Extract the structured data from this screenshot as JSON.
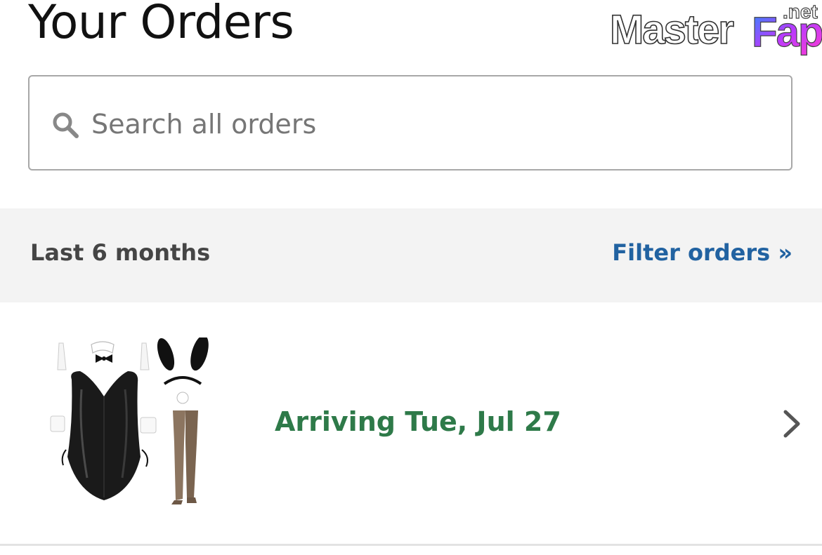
{
  "header": {
    "title": "Your Orders"
  },
  "watermark": {
    "text_main": "Master",
    "text_accent": "Fap",
    "text_suffix": ".net",
    "accent_colors": [
      "#2a8cff",
      "#b63bff",
      "#ff3bd1"
    ]
  },
  "search": {
    "placeholder": "Search all orders",
    "value": "",
    "icon": "search-icon"
  },
  "filter": {
    "period_label": "Last 6 months",
    "filter_link": "Filter orders »"
  },
  "orders": [
    {
      "status": "Arriving Tue, Jul 27",
      "status_color": "#2e7a49",
      "image": "bunny-costume-set",
      "icon": "chevron-right-icon"
    }
  ],
  "colors": {
    "link": "#2162a1",
    "filter_bar_bg": "#f3f3f3",
    "title": "#111111"
  }
}
